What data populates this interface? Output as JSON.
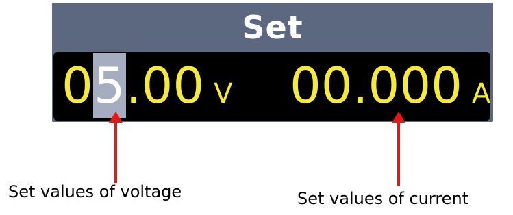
{
  "header": {
    "title": "Set"
  },
  "voltage": {
    "prefix": "0",
    "cursor_digit": "5",
    "suffix": ".00",
    "unit": "V"
  },
  "current": {
    "value": "00.000",
    "unit": "A"
  },
  "annotations": {
    "voltage_caption": "Set values of voltage",
    "current_caption": "Set values of current"
  },
  "colors": {
    "panel": "#5b6880",
    "display_bg": "#000000",
    "digits": "#f5e93a",
    "cursor_bg": "#a5adc1",
    "arrow": "#e11919"
  }
}
